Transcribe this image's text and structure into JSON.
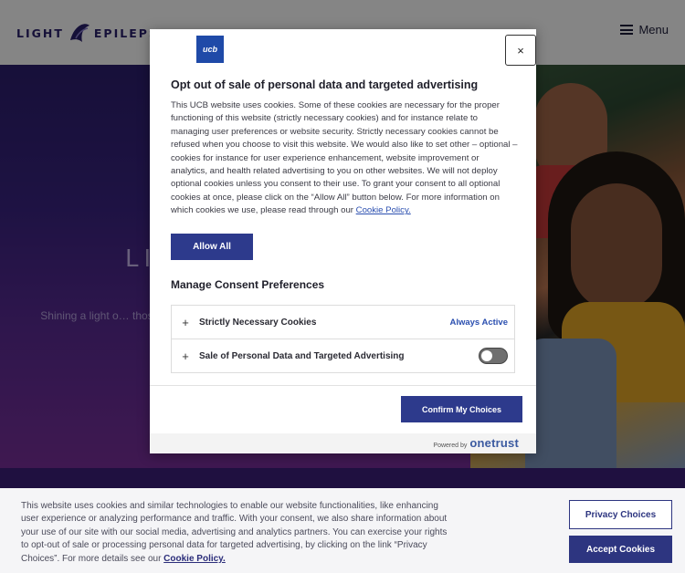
{
  "site": {
    "logo_left": "LIGHT",
    "logo_right": "EPILEPSY",
    "menu_label": "Menu",
    "hero_title": "LI",
    "hero_text": "Shining a light o… those who wor… of se…"
  },
  "modal": {
    "brand_logo_text": "ucb",
    "close_label": "×",
    "title": "Opt out of sale of personal data and targeted advertising",
    "body": "This UCB website uses cookies. Some of these cookies are necessary for the proper functioning of this website (strictly necessary cookies) and for instance relate to managing user preferences or website security. Strictly necessary cookies cannot be refused when you choose to visit this website. We would also like to set other – optional – cookies for instance for user experience enhancement, website improvement or analytics, and health related advertising to you on other websites. We will not deploy optional cookies unless you consent to their use. To grant your consent to all optional cookies at once, please click on the “Allow All” button below. For more information on which cookies we use, please read through our ",
    "cookie_policy_link": "Cookie Policy.",
    "allow_all_label": "Allow All",
    "manage_title": "Manage Consent Preferences",
    "preferences": [
      {
        "label": "Strictly Necessary Cookies",
        "status": "Always Active"
      },
      {
        "label": "Sale of Personal Data and Targeted Advertising",
        "enabled": false
      }
    ],
    "confirm_label": "Confirm My Choices",
    "powered_by": "Powered by",
    "powered_brand": "onetrust"
  },
  "banner": {
    "text": "This website uses cookies and similar technologies to enable our website functionalities, like enhancing user experience or analyzing performance and traffic. With your consent, we also share information about your use of our site with our social media, advertising and analytics partners. You can exercise your rights to opt-out of sale or processing personal data for targeted advertising, by clicking on the link “Privacy Choices”. For more details see our ",
    "link": "Cookie Policy.",
    "privacy_choices_label": "Privacy Choices",
    "accept_label": "Accept Cookies"
  },
  "colors": {
    "primary_button": "#2d3a8c",
    "link": "#2b4fb0",
    "hero_top": "#2c1f6e",
    "hero_bottom": "#7a2f9b"
  }
}
